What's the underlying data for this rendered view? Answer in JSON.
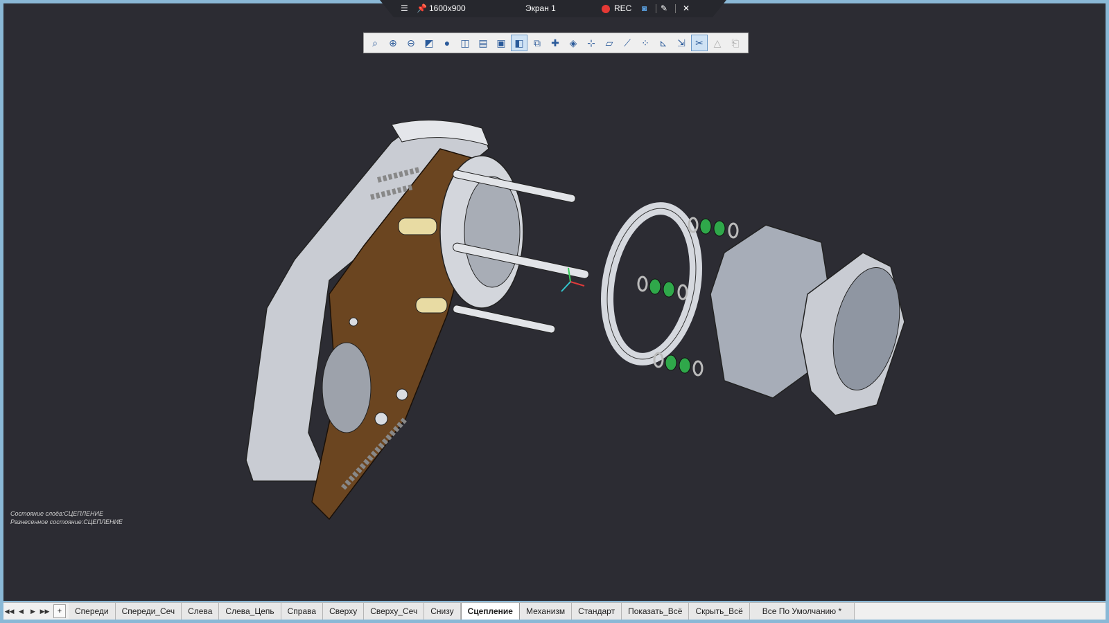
{
  "topbar": {
    "resolution": "1600x900",
    "screen_name": "Экран 1",
    "rec_label": "REC",
    "menu_icon": "hamburger-menu-icon",
    "pin_icon": "pin-icon",
    "camera_icon": "camera-icon",
    "pen_icon": "pen-icon",
    "close_icon": "close-icon",
    "rec_color": "#e53935"
  },
  "toolbar": {
    "buttons": [
      {
        "name": "zoom-window-icon",
        "glyph": "⌕",
        "state": "normal"
      },
      {
        "name": "zoom-in-icon",
        "glyph": "⊕",
        "state": "normal"
      },
      {
        "name": "zoom-out-icon",
        "glyph": "⊖",
        "state": "normal"
      },
      {
        "name": "zoom-fit-icon",
        "glyph": "◩",
        "state": "normal"
      },
      {
        "name": "shading-icon",
        "glyph": "●",
        "state": "normal"
      },
      {
        "name": "view-cube-icon",
        "glyph": "◫",
        "state": "normal"
      },
      {
        "name": "section-view-icon",
        "glyph": "▤",
        "state": "normal"
      },
      {
        "name": "camera-view-icon",
        "glyph": "▣",
        "state": "normal"
      },
      {
        "name": "select-filter-icon",
        "glyph": "◧",
        "state": "active"
      },
      {
        "name": "insert-part-icon",
        "glyph": "⧉",
        "state": "normal"
      },
      {
        "name": "add-component-icon",
        "glyph": "✚",
        "state": "normal"
      },
      {
        "name": "properties-icon",
        "glyph": "◈",
        "state": "normal"
      },
      {
        "name": "axes-icon",
        "glyph": "⊹",
        "state": "normal"
      },
      {
        "name": "plane-icon",
        "glyph": "▱",
        "state": "normal"
      },
      {
        "name": "line-icon",
        "glyph": "⟋",
        "state": "normal"
      },
      {
        "name": "points-icon",
        "glyph": "⁘",
        "state": "normal"
      },
      {
        "name": "coordinate-system-icon",
        "glyph": "⊾",
        "state": "normal"
      },
      {
        "name": "transform-icon",
        "glyph": "⇲",
        "state": "normal"
      },
      {
        "name": "explode-icon",
        "glyph": "✂",
        "state": "active"
      },
      {
        "name": "constraint-icon",
        "glyph": "△",
        "state": "disabled"
      },
      {
        "name": "export-icon",
        "glyph": "⎗",
        "state": "disabled"
      }
    ]
  },
  "status": {
    "line1": "Состояние слоёв:СЦЕПЛЕНИЕ",
    "line2": "Разнесенное состояние:СЦЕПЛЕНИЕ"
  },
  "tabs": {
    "nav_first": "◀◀",
    "nav_prev": "◀",
    "nav_next": "▶",
    "nav_last": "▶▶",
    "add": "+",
    "items": [
      "Спереди",
      "Спереди_Сеч",
      "Слева",
      "Слева_Цепь",
      "Справа",
      "Сверху",
      "Сверху_Сеч",
      "Снизу",
      "Сцепление",
      "Механизм",
      "Стандарт",
      "Показать_Всё",
      "Скрыть_Всё",
      "Все По Умолчанию *"
    ],
    "active_index": 8
  },
  "colors": {
    "viewport_bg": "#2c2c33",
    "plate_brown": "#6b4520",
    "part_grey": "#c8ccd4",
    "washer_green": "#2fa84a",
    "brass": "#e8dba3"
  }
}
